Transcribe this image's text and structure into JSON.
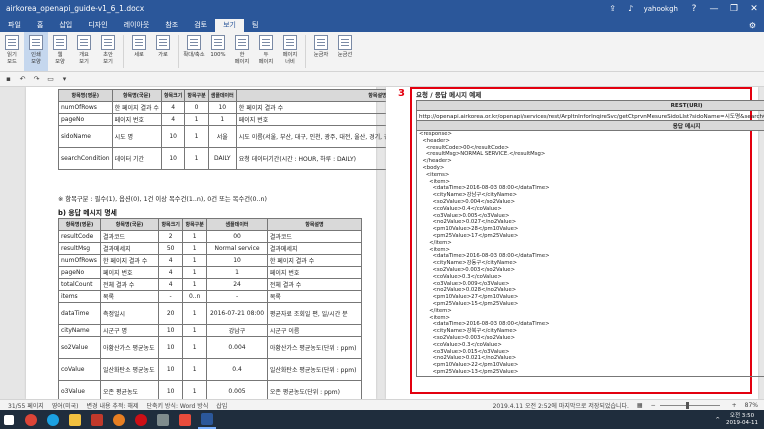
{
  "window": {
    "title": "airkorea_openapi_guide-v1_6_1.docx",
    "user": "yahookgh",
    "help": "?",
    "minimize": "—",
    "restore": "❐",
    "close": "✕"
  },
  "tabs": [
    "파일",
    "홈",
    "삽입",
    "디자인",
    "레이아웃",
    "참조",
    "검토",
    "보기",
    "팀"
  ],
  "active_tab": "보기",
  "ribbon": [
    {
      "label": "읽기\n모드"
    },
    {
      "label": "인쇄\n모양"
    },
    {
      "label": "웹\n모양"
    },
    {
      "label": "개요\n보기"
    },
    {
      "label": "초안\n보기"
    },
    {
      "label": "세로"
    },
    {
      "label": "가로"
    },
    {
      "label": "확대/축소"
    },
    {
      "label": "100%"
    },
    {
      "label": "한\n페이지"
    },
    {
      "label": "두\n페이지"
    },
    {
      "label": "페이지\n너비"
    },
    {
      "label": "눈금자"
    },
    {
      "label": "눈금선"
    }
  ],
  "left_page": {
    "table1": {
      "headers": [
        "항목명(영문)",
        "항목명(국문)",
        "항목크기",
        "항목구분",
        "샘플데이터",
        "항목설명"
      ],
      "rows": [
        [
          "numOfRows",
          "한 페이지 결과 수",
          "4",
          "0",
          "10",
          "한 페이지 결과 수"
        ],
        [
          "pageNo",
          "페이지 번호",
          "4",
          "1",
          "1",
          "페이지 번호"
        ],
        [
          "sidoName",
          "시도 명",
          "10",
          "1",
          "서울",
          "시도 이름(서울, 부산, 대구, 인천, 광주, 대전, 울산, 경기, 강원, 충북, 충남, 전북, 전남, 경북, 경남, 제주, 세종)"
        ],
        [
          "searchCondition",
          "데이터 기간",
          "10",
          "1",
          "DAILY",
          "요청 데이터기간(시간 : HOUR, 하루 : DAILY)"
        ]
      ]
    },
    "note": "※ 항목구분 : 필수(1), 옵션(0), 1건 이상 복수건(1..n), 0건 또는 복수건(0..n)",
    "section": "b) 응답 메시지 명세",
    "table2": {
      "headers": [
        "항목명(영문)",
        "항목명(국문)",
        "항목크기",
        "항목구분",
        "샘플데이터",
        "항목설명"
      ],
      "rows": [
        [
          "resultCode",
          "결과코드",
          "2",
          "1",
          "00",
          "결과코드"
        ],
        [
          "resultMsg",
          "결과메세지",
          "50",
          "1",
          "Normal service",
          "결과메세지"
        ],
        [
          "numOfRows",
          "한 페이지 결과 수",
          "4",
          "1",
          "10",
          "한 페이지 결과 수"
        ],
        [
          "pageNo",
          "페이지 번호",
          "4",
          "1",
          "1",
          "페이지 번호"
        ],
        [
          "totalCount",
          "전체 결과 수",
          "4",
          "1",
          "24",
          "전체 결과 수"
        ],
        [
          "items",
          "목록",
          "-",
          "0..n",
          "-",
          "목록"
        ],
        [
          "dataTime",
          "측정일시",
          "20",
          "1",
          "2016-07-21 08:00",
          "평균자료 조회일 편, 일/시간 분"
        ],
        [
          "cityName",
          "시군구 명",
          "10",
          "1",
          "강남구",
          "시군구 이름"
        ],
        [
          "so2Value",
          "아황산가스 평균농도",
          "10",
          "1",
          "0.004",
          "아황산가스 평균농도(단위 : ppm)"
        ],
        [
          "coValue",
          "일산화탄소 평균농도",
          "10",
          "1",
          "0.4",
          "일산화탄소 평균농도(단위 : ppm)"
        ],
        [
          "o3Value",
          "오존 평균농도",
          "10",
          "1",
          "0.005",
          "오존 평균농도(단위 : ppm)"
        ],
        [
          "no2Value",
          "이산화질소 평균농도",
          "10",
          "1",
          "0.027",
          "이산화질소 평균농도"
        ]
      ]
    }
  },
  "right_page": {
    "marker": "3",
    "title": "요청 / 응답 메시지 예제",
    "rest_header": "REST(URI)",
    "rest_url": "http://openapi.airkorea.or.kr/openapi/services/rest/ArpltnInforInqireSvc/getCtprvnMesureSidoLIst?sidoName=시도명&searchCondition=DAILY&pageNo=1&numOfRows=10&ServiceKey=서비스키",
    "resp_header": "응답 메시지",
    "xml_lines": [
      "<response>",
      "  <header>",
      "    <resultCode>00</resultCode>",
      "    <resultMsg>NORMAL SERVICE.</resultMsg>",
      "  </header>",
      "  <body>",
      "    <items>",
      "      <item>",
      "        <dataTime>2016-08-03 08:00</dataTime>",
      "        <cityName>강남구</cityName>",
      "        <so2Value>0.004</so2Value>",
      "        <coValue>0.4</coValue>",
      "        <o3Value>0.005</o3Value>",
      "        <no2Value>0.027</no2Value>",
      "        <pm10Value>28</pm10Value>",
      "        <pm25Value>17</pm25Value>",
      "      </item>",
      "      <item>",
      "        <dataTime>2016-08-03 08:00</dataTime>",
      "        <cityName>강동구</cityName>",
      "        <so2Value>0.003</so2Value>",
      "        <coValue>0.3</coValue>",
      "        <o3Value>0.009</o3Value>",
      "        <no2Value>0.028</no2Value>",
      "        <pm10Value>27</pm10Value>",
      "        <pm25Value>15</pm25Value>",
      "      </item>",
      "      <item>",
      "        <dataTime>2016-08-03 08:00</dataTime>",
      "        <cityName>강북구</cityName>",
      "        <so2Value>0.003</so2Value>",
      "        <coValue>0.3</coValue>",
      "        <o3Value>0.015</o3Value>",
      "        <no2Value>0.021</no2Value>",
      "        <pm10Value>22</pm10Value>",
      "        <pm25Value>13</pm25Value>"
    ]
  },
  "status": {
    "page": "31/55 페이지",
    "language": "영어(미국)",
    "track": "변경 내용 추적: 해제",
    "insert_mode": "단축키 방식: Word 방식",
    "insert": "삽입",
    "saved": "2019.4.11 오전 2:52에 마지막으로 저장되었습니다.",
    "zoom": "87%"
  },
  "taskbar": {
    "time": "오전 3:50",
    "date": "2019-04-11"
  },
  "colors": {
    "accent": "#2b579a",
    "highlight": "#e3000f"
  }
}
